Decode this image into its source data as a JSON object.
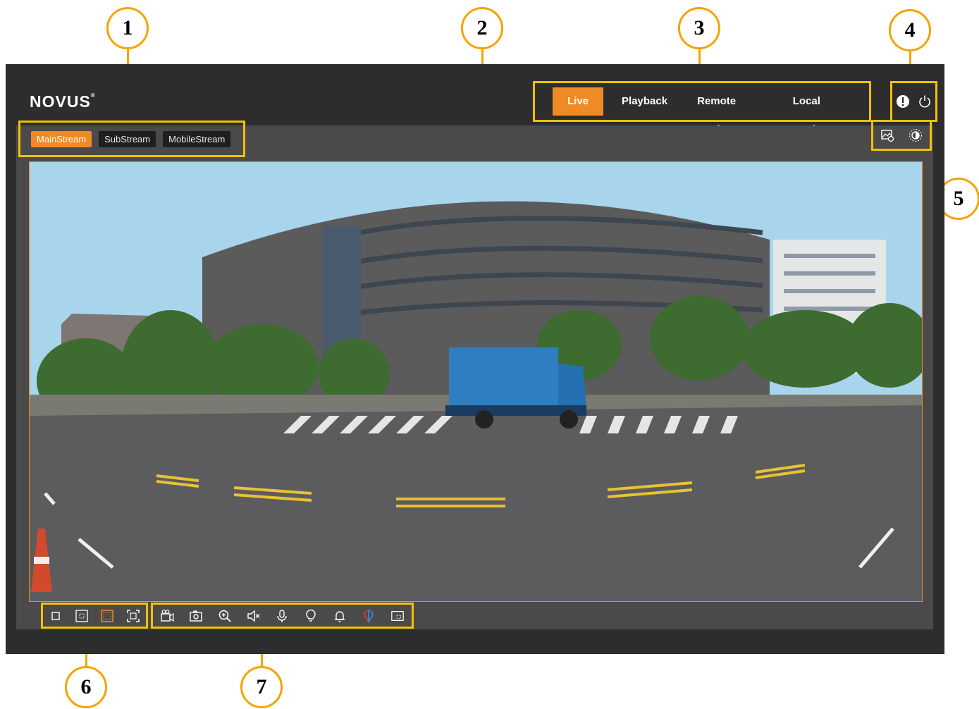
{
  "callouts": [
    "1",
    "2",
    "3",
    "4",
    "5",
    "6",
    "7"
  ],
  "brand": {
    "logo": "NOVUS"
  },
  "nav": {
    "tabs": [
      "Live",
      "Playback",
      "Remote Setting",
      "Local Settings"
    ],
    "active": "Live"
  },
  "streams": {
    "buttons": [
      "MainStream",
      "SubStream",
      "MobileStream"
    ],
    "active": "MainStream"
  },
  "top_icons": [
    "alarm-info-icon",
    "power-icon"
  ],
  "video_tools_right": [
    "image-settings-icon",
    "exposure-icon"
  ],
  "window_layout_icons": [
    "original-scale-icon",
    "stretch-icon",
    "fit-icon",
    "fullscreen-icon"
  ],
  "toolbar_icons": [
    "record-icon",
    "snapshot-icon",
    "zoom-in-icon",
    "audio-mute-icon",
    "microphone-icon",
    "light-icon",
    "alarm-bell-icon",
    "red-blue-light-icon",
    "roi-icon"
  ],
  "colors": {
    "accent": "#f08a24",
    "callout_border": "#f5a300",
    "highlight_box": "#f5c000",
    "background": "#2d2d2d",
    "panel": "#4a4a4a"
  }
}
